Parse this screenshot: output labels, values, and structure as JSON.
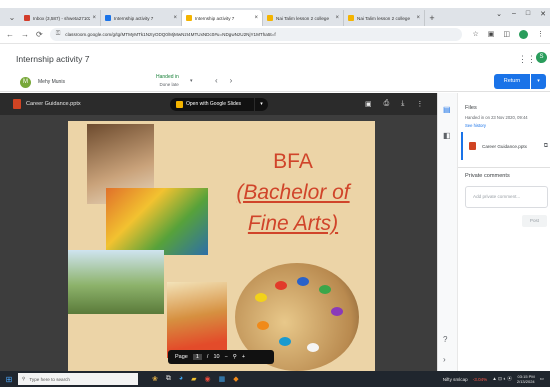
{
  "browser": {
    "tabs": [
      {
        "title": "Inbox (3,587) - shweta27102",
        "fav_color": "#d33d2b",
        "active": false
      },
      {
        "title": "Internship activity 7",
        "fav_color": "#1a73e8",
        "active": false
      },
      {
        "title": "Internship activity 7",
        "fav_color": "#f4b400",
        "active": true
      },
      {
        "title": "Nai Talim lesson 2 college",
        "fav_color": "#f4b400",
        "active": false
      },
      {
        "title": "Nai Talim lesson 2 college",
        "fav_color": "#f4b400",
        "active": false
      }
    ],
    "tab_close_glyph": "×",
    "new_tab_glyph": "+",
    "window_controls": {
      "chevron": "⌄",
      "minimize": "–",
      "maximize": "□",
      "close": "✕"
    },
    "url": "classroom.google.com/g/tg/MTMyMTk1NzIyODQ0/MjMwNzI4MTUxNDc0#u=NDgwNzU2NjY1MTha5t=f",
    "nav": {
      "back": "←",
      "forward": "→",
      "reload": "⟳"
    }
  },
  "classroom": {
    "title": "Internship activity 7",
    "apps_glyph": "⋮⋮⋮",
    "account_initial": "S",
    "student": {
      "initial": "M",
      "name": "Mehy Munis"
    },
    "status": {
      "line1": "Handed in",
      "line2": "Done late"
    },
    "caret": "▾",
    "nav_prev": "‹",
    "nav_next": "›",
    "return_label": "Return",
    "return_dropdown": "▾"
  },
  "viewer": {
    "file_name": "Career Guidance.pptx",
    "open_with_label": "Open with Google Slides",
    "open_dropdown": "▾",
    "tool_icons": [
      "▣",
      "⎙",
      "⤓",
      "⋮"
    ],
    "slide": {
      "line1": "BFA",
      "line2": "(Bachelor of",
      "line3": "Fine Arts)"
    },
    "page": {
      "label": "Page",
      "current": "1",
      "sep": "/",
      "total": "10",
      "zoom_out": "−",
      "zoom_icon": "⚲",
      "zoom_in": "+"
    }
  },
  "panel": {
    "files_heading": "Files",
    "files_sub": "Handed in on 23 Nov 2020, 09:44",
    "see_history": "See history",
    "file_name": "Career Guidance.pptx",
    "open_icon": "⧉",
    "comments_heading": "Private comments",
    "comment_placeholder": "Add private comment...",
    "post_label": "Post",
    "rail_help": "?",
    "rail_expand": "›"
  },
  "taskbar": {
    "search_placeholder": "Type here to search",
    "tray_label": "Nifty smlcap",
    "tray_change": "-3.04%",
    "time": "03:15 PM",
    "date": "2/13/2024"
  }
}
